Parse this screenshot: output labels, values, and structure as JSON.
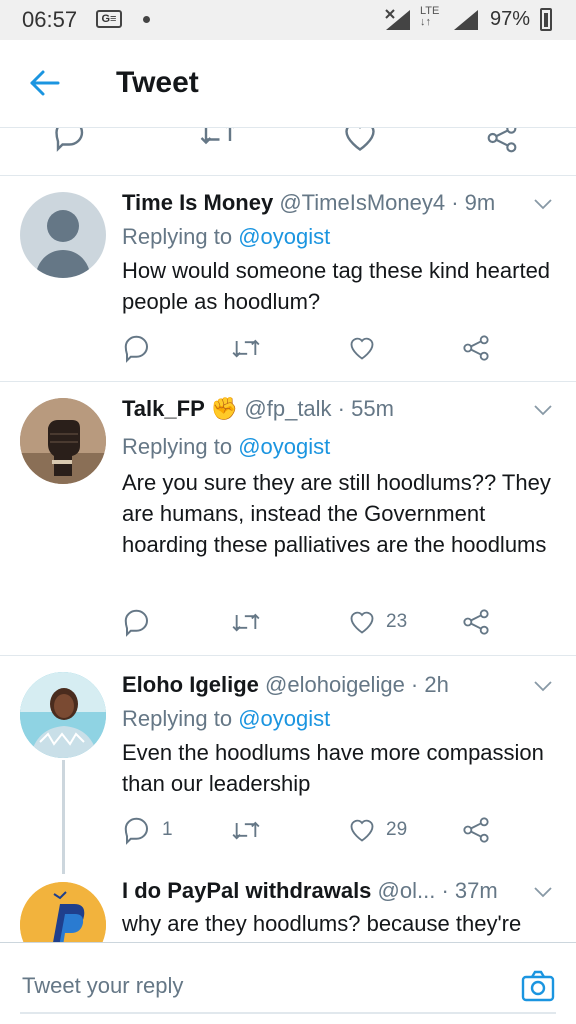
{
  "status_bar": {
    "time": "06:57",
    "ge_icon": "G≡",
    "lte": "LTE",
    "battery": "97%"
  },
  "header": {
    "title": "Tweet",
    "back_icon": "arrow-left-icon"
  },
  "colors": {
    "accent": "#1b95e0",
    "text": "#14171a",
    "muted": "#657786",
    "divider": "#e1e8ed",
    "paypal_bg": "#f2b33d"
  },
  "tweets": [
    {
      "name": "Time Is Money",
      "handle": "@TimeIsMoney4",
      "time": " · 9m",
      "replying_prefix": "Replying to ",
      "replying_to": "@oyogist",
      "text": "How would someone tag these kind hearted people as hoodlum?",
      "replies": "",
      "likes": ""
    },
    {
      "name": "Talk_FP",
      "badge": "✊",
      "handle": "@fp_talk",
      "time": " · 55m",
      "replying_prefix": "Replying to ",
      "replying_to": "@oyogist",
      "text": "Are you sure they are still hoodlums?? They are humans, instead the Government hoarding these palliatives are the hoodlums",
      "replies": "",
      "likes": "23"
    },
    {
      "name": "Eloho Igelige",
      "handle": "@elohoigelige",
      "time": " · 2h",
      "replying_prefix": "Replying to ",
      "replying_to": "@oyogist",
      "text": "Even the hoodlums have more compassion than our leadership",
      "replies": "1",
      "likes": "29"
    },
    {
      "name": "I do PayPal withdrawals",
      "handle": "@ol...",
      "time": " · 37m",
      "text": "why are they hoodlums? because they're"
    }
  ],
  "reply_bar": {
    "placeholder": "Tweet your reply",
    "camera_icon": "camera-icon"
  }
}
